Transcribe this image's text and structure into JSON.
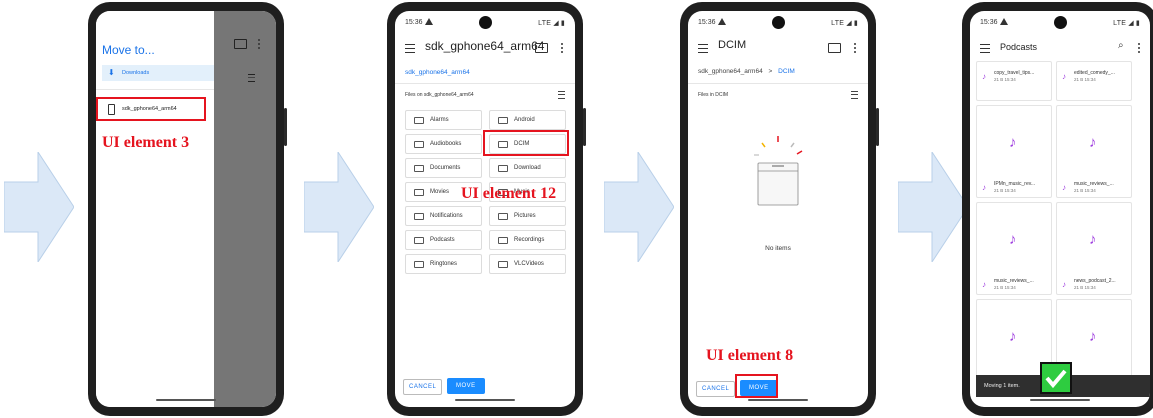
{
  "status": {
    "time": "15:36",
    "network": "LTE"
  },
  "screen1": {
    "title": "Move to...",
    "downloads_label": "Downloads",
    "device_label": "sdk_gphone64_arm64",
    "annotation": "UI element 3"
  },
  "screen2": {
    "title": "sdk_gphone64_arm64",
    "breadcrumb": "sdk_gphone64_arm64",
    "section": "Files on sdk_gphone64_arm64",
    "folders": [
      "Alarms",
      "Android",
      "Audiobooks",
      "DCIM",
      "Documents",
      "Download",
      "Movies",
      "Music",
      "Notifications",
      "Pictures",
      "Podcasts",
      "Recordings",
      "Ringtones",
      "VLCVideos"
    ],
    "cancel": "CANCEL",
    "move": "MOVE",
    "annotation": "UI element 12"
  },
  "screen3": {
    "title": "DCIM",
    "breadcrumb_root": "sdk_gphone64_arm64",
    "breadcrumb_sep": ">",
    "breadcrumb_current": "DCIM",
    "section": "Files in DCIM",
    "empty": "No items",
    "cancel": "CANCEL",
    "move": "MOVE",
    "annotation": "UI element 8"
  },
  "screen4": {
    "title": "Podcasts",
    "files": [
      {
        "name": "copy_travel_tips...",
        "meta": "21 B 15:34"
      },
      {
        "name": "edited_comedy_...",
        "meta": "21 B 15:34"
      },
      {
        "name": "IPMn_music_rev...",
        "meta": "21 B 15:34"
      },
      {
        "name": "music_reviews_...",
        "meta": "21 B 15:34"
      },
      {
        "name": "music_reviews_...",
        "meta": "21 B 15:34"
      },
      {
        "name": "news_podcast_2...",
        "meta": "21 B 15:34"
      }
    ],
    "toast": "Moving 1 item."
  },
  "colors": {
    "accent": "#1a73e8",
    "annotation": "#e5141f",
    "music": "#a040e0",
    "success": "#2ecc40"
  }
}
